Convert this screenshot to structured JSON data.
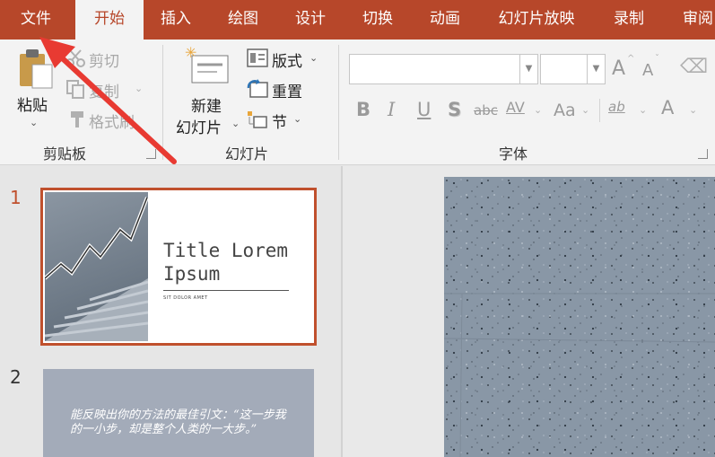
{
  "menu_tabs": [
    "文件",
    "开始",
    "插入",
    "绘图",
    "设计",
    "切换",
    "动画",
    "幻灯片放映",
    "录制",
    "审阅"
  ],
  "active_tab": "开始",
  "ribbon": {
    "clipboard": {
      "paste": "粘贴",
      "cut": "剪切",
      "copy": "复制",
      "format_painter": "格式刷",
      "group_label": "剪贴板"
    },
    "slides": {
      "new_slide_line1": "新建",
      "new_slide_line2": "幻灯片",
      "layout": "版式",
      "reset": "重置",
      "section": "节",
      "group_label": "幻灯片"
    },
    "font": {
      "font_name": "",
      "font_size": "",
      "grow_font": "A",
      "shrink_font": "A",
      "format_buttons": [
        "B",
        "I",
        "U",
        "S",
        "abc",
        "AV",
        "Aa",
        "ab",
        "A"
      ],
      "group_label": "字体"
    }
  },
  "slides": {
    "thumbnails": [
      {
        "number": "1",
        "title": "Title Lorem\nIpsum",
        "subtitle": "SIT DOLOR AMET"
      },
      {
        "number": "2",
        "quote": "能反映出你的方法的最佳引文：“这一步我的一小步，却是整个人类的一大步。”"
      }
    ]
  },
  "colors": {
    "accent": "#b7472a",
    "selected_border": "#c0502d"
  }
}
